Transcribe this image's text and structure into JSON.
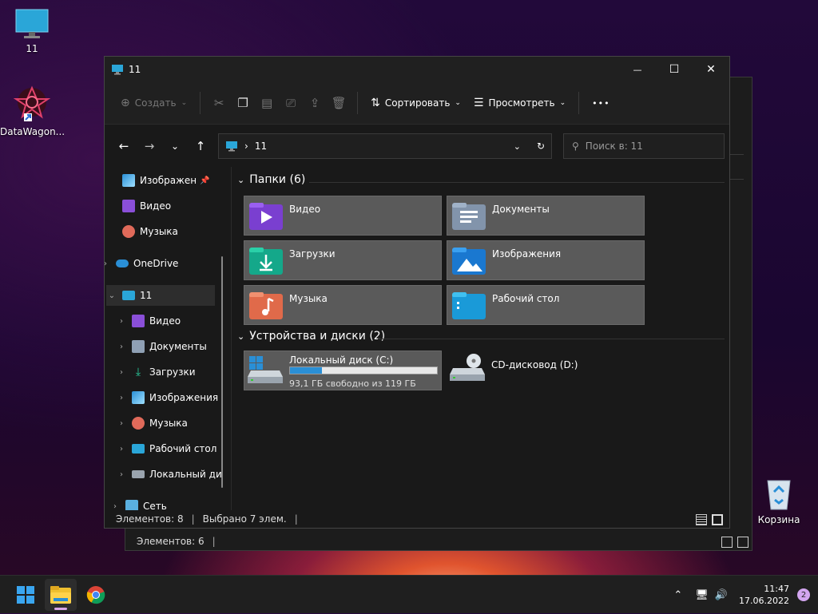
{
  "desktop": {
    "icons": [
      {
        "label": "11",
        "icon": "monitor-icon"
      },
      {
        "label": "DataWagon...",
        "icon": "datawagon-icon"
      },
      {
        "label": "Корзина",
        "icon": "recycle-bin-icon"
      }
    ]
  },
  "back_window": {
    "status": "Элементов: 6"
  },
  "window": {
    "title": "11",
    "controls": {
      "minimize": "—",
      "maximize": "☐",
      "close": "✕"
    },
    "toolbar": {
      "create": "Создать",
      "sort": "Сортировать",
      "view": "Просмотреть",
      "more": "•••"
    },
    "address": {
      "path": "11",
      "search_placeholder": "Поиск в: 11"
    },
    "nav": {
      "items": [
        {
          "label": "Изображен",
          "icon": "pictures-icon"
        },
        {
          "label": "Видео",
          "icon": "videos-icon"
        },
        {
          "label": "Музыка",
          "icon": "music-icon"
        },
        {
          "label": "OneDrive",
          "icon": "onedrive-icon"
        },
        {
          "label": "11",
          "icon": "monitor-icon"
        },
        {
          "label": "Видео",
          "icon": "videos-icon"
        },
        {
          "label": "Документы",
          "icon": "documents-icon"
        },
        {
          "label": "Загрузки",
          "icon": "downloads-icon"
        },
        {
          "label": "Изображения",
          "icon": "pictures-icon"
        },
        {
          "label": "Музыка",
          "icon": "music-icon"
        },
        {
          "label": "Рабочий стол",
          "icon": "desktop-icon"
        },
        {
          "label": "Локальный ди",
          "icon": "drive-icon"
        },
        {
          "label": "Сеть",
          "icon": "network-icon"
        }
      ]
    },
    "folders": {
      "header": "Папки (6)",
      "items": [
        {
          "label": "Видео",
          "icon": "videos-folder-icon"
        },
        {
          "label": "Документы",
          "icon": "documents-folder-icon"
        },
        {
          "label": "Загрузки",
          "icon": "downloads-folder-icon"
        },
        {
          "label": "Изображения",
          "icon": "pictures-folder-icon"
        },
        {
          "label": "Музыка",
          "icon": "music-folder-icon"
        },
        {
          "label": "Рабочий стол",
          "icon": "desktop-folder-icon"
        }
      ]
    },
    "drives": {
      "header": "Устройства и диски (2)",
      "items": [
        {
          "label": "Локальный диск (C:)",
          "free": "93,1 ГБ свободно из 119 ГБ",
          "used_fraction": 0.22
        },
        {
          "label": "CD-дисковод (D:)"
        }
      ]
    },
    "status": {
      "count": "Элементов: 8",
      "selected": "Выбрано 7 элем.",
      "sep": "|"
    }
  },
  "taskbar": {
    "time": "11:47",
    "date": "17.06.2022",
    "notifications": "2",
    "apps": [
      "start-icon",
      "file-explorer-icon",
      "chrome-icon"
    ]
  },
  "colors": {
    "accent": "#2a8fd6",
    "tile": "#5a5a5a",
    "window_bg": "#191919"
  }
}
